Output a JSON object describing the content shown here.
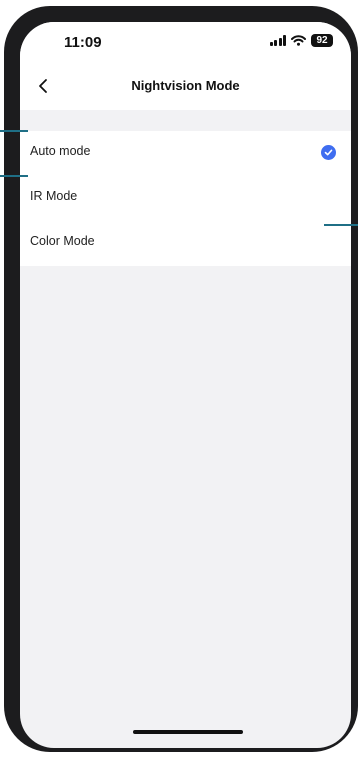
{
  "status_bar": {
    "time": "11:09",
    "battery": "92"
  },
  "nav": {
    "title": "Nightvision Mode"
  },
  "options": [
    {
      "label": "Auto mode",
      "selected": true
    },
    {
      "label": "IR Mode",
      "selected": false
    },
    {
      "label": "Color Mode",
      "selected": false
    }
  ],
  "colors": {
    "accent": "#3f6df0",
    "callout": "#1f6f86",
    "frame": "#1c1c1e",
    "background": "#f2f2f4"
  },
  "icons": [
    "back-chevron-icon",
    "signal-icon",
    "wifi-icon",
    "battery-icon",
    "checkmark-icon"
  ]
}
